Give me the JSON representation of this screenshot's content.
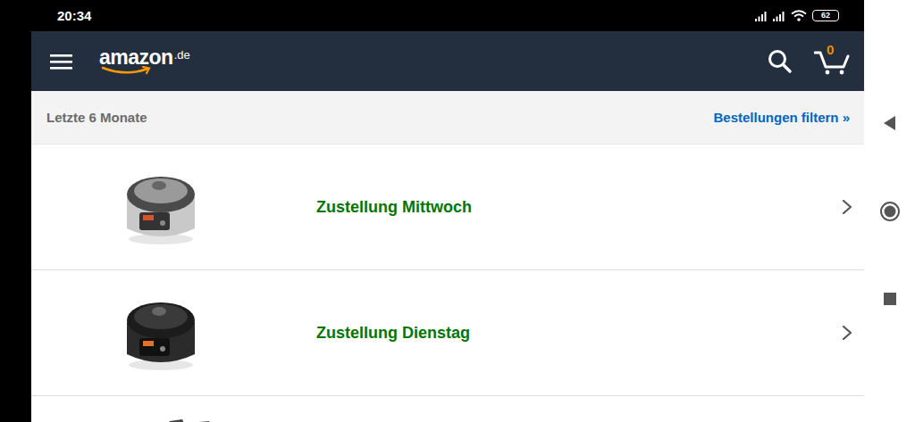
{
  "status_bar": {
    "time": "20:34",
    "battery": "62"
  },
  "header": {
    "logo": {
      "name": "amazon",
      "suffix": ".de"
    },
    "cart_count": "0"
  },
  "filter_bar": {
    "period": "Letzte 6 Monate",
    "filter_link": "Bestellungen filtern »"
  },
  "orders": [
    {
      "status": "Zustellung Mittwoch",
      "variant": "silver"
    },
    {
      "status": "Zustellung Dienstag",
      "variant": "black"
    }
  ]
}
